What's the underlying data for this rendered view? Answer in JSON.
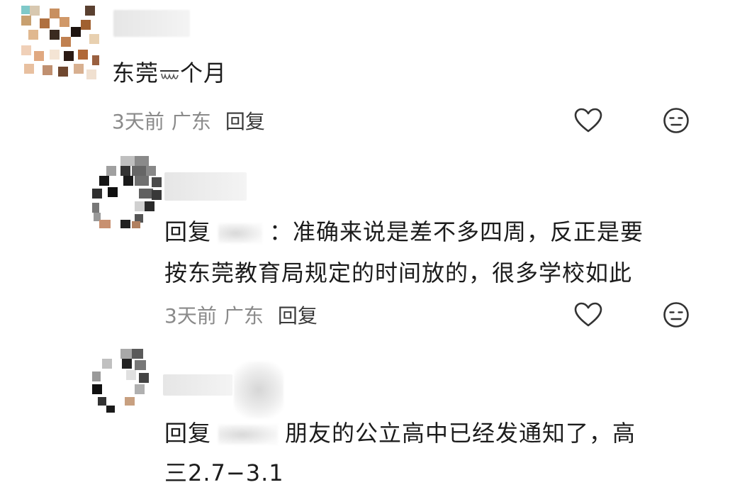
{
  "comments": [
    {
      "text_before": "东莞",
      "text_after": "个月",
      "time": "3天前",
      "location": "广东",
      "reply_label": "回复",
      "like_icon": "heart-outline-icon",
      "dislike_icon": "meh-face-icon"
    },
    {
      "reply_prefix": "回复",
      "line1": "：准确来说是差不多四周，反正是要",
      "line2": "按东莞教育局规定的时间放的，很多学校如此",
      "time": "3天前",
      "location": "广东",
      "reply_label": "回复",
      "like_icon": "heart-outline-icon",
      "dislike_icon": "meh-face-icon"
    },
    {
      "reply_prefix": "回复",
      "line1": "朋友的公立高中已经发通知了，高",
      "line2": "三2.7−3.1"
    }
  ],
  "colors": {
    "text": "#1c1c1c",
    "meta": "#8a8a8a",
    "icon": "#333333",
    "background": "#ffffff"
  }
}
